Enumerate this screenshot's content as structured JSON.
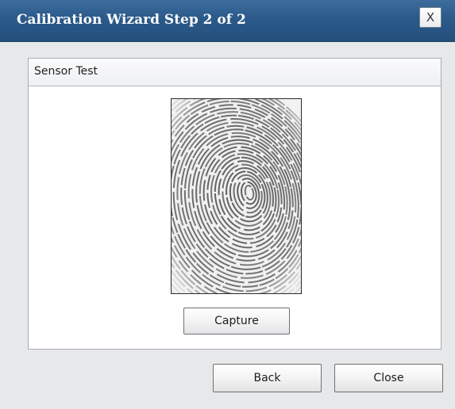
{
  "window": {
    "title": "Calibration Wizard Step 2 of 2",
    "close_label": "X"
  },
  "panel": {
    "title": "Sensor Test",
    "image_alt": "fingerprint-scan"
  },
  "buttons": {
    "capture": "Capture",
    "back": "Back",
    "close": "Close"
  },
  "colors": {
    "titlebar": "#2b5a8a",
    "title_text": "#ffffff",
    "background": "#e6e8ea",
    "panel": "#ffffff"
  }
}
